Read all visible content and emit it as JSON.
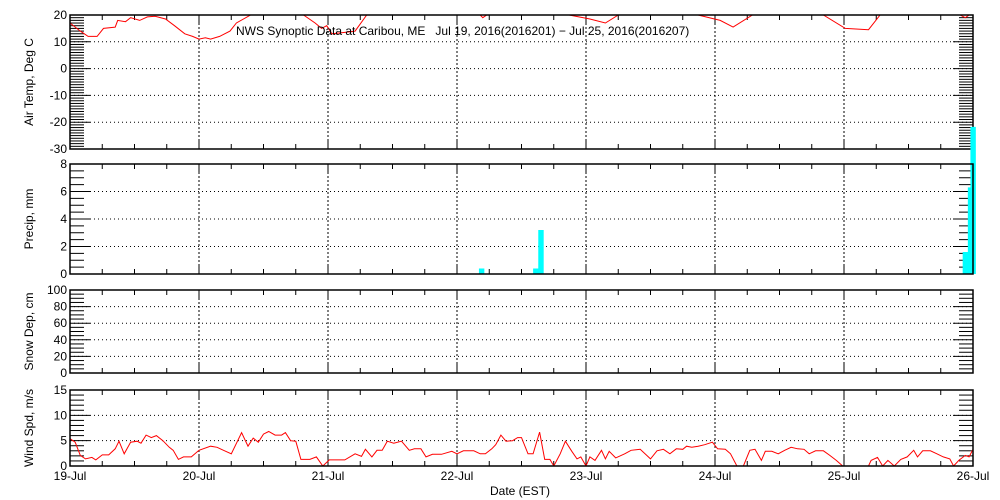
{
  "chart_data": {
    "type": "line",
    "title": "NWS Synoptic Data at Caribou, ME   Jul 19, 2016(2016201) − Jul 25, 2016(2016207)",
    "xlabel": "Date (EST)",
    "x_units": "days since 19-Jul 00:00",
    "xlim": [
      0,
      7
    ],
    "x_tick_labels": [
      "19-Jul",
      "20-Jul",
      "21-Jul",
      "22-Jul",
      "23-Jul",
      "24-Jul",
      "25-Jul",
      "26-Jul"
    ],
    "grid": true,
    "colors": {
      "line": "#ff0000",
      "bar": "#00ffff",
      "axis": "#000000"
    },
    "panels": [
      {
        "id": "temp",
        "ylabel": "Air Temp, Deg C",
        "ylim": [
          -30,
          20
        ],
        "ticks": [
          "-30",
          "-20",
          "-10",
          "0",
          "10",
          "20"
        ],
        "major": 10,
        "minor": 1,
        "kind": "line",
        "points": [
          [
            0,
            17
          ],
          [
            0.08,
            14
          ],
          [
            0.14,
            12
          ],
          [
            0.21,
            12
          ],
          [
            0.26,
            15
          ],
          [
            0.35,
            15.5
          ],
          [
            0.37,
            18
          ],
          [
            0.43,
            17.5
          ],
          [
            0.47,
            19
          ],
          [
            0.54,
            18
          ],
          [
            0.6,
            19.3
          ],
          [
            0.66,
            19.5
          ],
          [
            0.74,
            18.5
          ],
          [
            0.81,
            16
          ],
          [
            0.89,
            13
          ],
          [
            0.95,
            12
          ],
          [
            1.0,
            11
          ],
          [
            1.05,
            11.5
          ],
          [
            1.09,
            11
          ],
          [
            1.16,
            12
          ],
          [
            1.24,
            14
          ],
          [
            1.29,
            17
          ],
          [
            1.4,
            20
          ],
          [
            1.47,
            23
          ],
          [
            1.71,
            23
          ],
          [
            1.81,
            20
          ],
          [
            1.9,
            17
          ],
          [
            1.95,
            15
          ],
          [
            1.99,
            16
          ],
          [
            2.03,
            13
          ],
          [
            2.13,
            13.5
          ],
          [
            2.21,
            14
          ],
          [
            2.3,
            20
          ],
          [
            2.4,
            24
          ],
          [
            3.1,
            24
          ],
          [
            3.18,
            20
          ],
          [
            3.2,
            19
          ],
          [
            3.26,
            21
          ],
          [
            3.49,
            24
          ],
          [
            3.8,
            24
          ],
          [
            3.87,
            20
          ],
          [
            4.03,
            18.5
          ],
          [
            4.15,
            17
          ],
          [
            4.25,
            20
          ],
          [
            4.34,
            24
          ],
          [
            4.81,
            24
          ],
          [
            4.87,
            20
          ],
          [
            5.04,
            18
          ],
          [
            5.14,
            15.5
          ],
          [
            5.29,
            20
          ],
          [
            5.39,
            24
          ],
          [
            5.74,
            24
          ],
          [
            5.84,
            20
          ],
          [
            6.01,
            15
          ],
          [
            6.19,
            14.5
          ],
          [
            6.28,
            20
          ],
          [
            6.36,
            24
          ],
          [
            6.82,
            24
          ],
          [
            6.9,
            20
          ],
          [
            6.94,
            19
          ],
          [
            7.0,
            21
          ]
        ]
      },
      {
        "id": "precip",
        "ylabel": "Precip, mm",
        "ylim": [
          0,
          8
        ],
        "ticks": [
          "0",
          "2",
          "4",
          "6",
          "8"
        ],
        "major": 2,
        "minor": 0.5,
        "kind": "bar",
        "bar_width_days": 0.042,
        "bars": [
          [
            3.17,
            0.4
          ],
          [
            3.59,
            0.4
          ],
          [
            3.63,
            3.2
          ],
          [
            6.92,
            1.6
          ],
          [
            6.96,
            6.3
          ],
          [
            6.98,
            10.7
          ]
        ]
      },
      {
        "id": "snow",
        "ylabel": "Snow Dep, cm",
        "ylim": [
          0,
          100
        ],
        "ticks": [
          "0",
          "20",
          "40",
          "60",
          "80",
          "100"
        ],
        "major": 20,
        "minor": 5,
        "kind": "none"
      },
      {
        "id": "wind",
        "ylabel": "Wind Spd, m/s",
        "ylim": [
          0,
          15
        ],
        "ticks": [
          "0",
          "5",
          "10",
          "15"
        ],
        "major": 5,
        "minor": 1,
        "kind": "line",
        "points": [
          [
            0,
            5.4
          ],
          [
            0.04,
            4.7
          ],
          [
            0.08,
            2.1
          ],
          [
            0.12,
            1.4
          ],
          [
            0.17,
            1.7
          ],
          [
            0.2,
            1.2
          ],
          [
            0.25,
            2.2
          ],
          [
            0.3,
            2.2
          ],
          [
            0.35,
            3.4
          ],
          [
            0.38,
            4.9
          ],
          [
            0.42,
            2.4
          ],
          [
            0.47,
            4.7
          ],
          [
            0.52,
            4.9
          ],
          [
            0.55,
            4.5
          ],
          [
            0.59,
            6.1
          ],
          [
            0.63,
            5.6
          ],
          [
            0.67,
            6.0
          ],
          [
            0.72,
            5.0
          ],
          [
            0.77,
            3.7
          ],
          [
            0.8,
            3.1
          ],
          [
            0.84,
            1.3
          ],
          [
            0.88,
            1.8
          ],
          [
            0.94,
            1.8
          ],
          [
            1.0,
            3.1
          ],
          [
            1.09,
            3.9
          ],
          [
            1.14,
            3.7
          ],
          [
            1.19,
            3.1
          ],
          [
            1.25,
            2.4
          ],
          [
            1.33,
            6.6
          ],
          [
            1.38,
            3.9
          ],
          [
            1.42,
            5.5
          ],
          [
            1.46,
            4.7
          ],
          [
            1.5,
            6.3
          ],
          [
            1.54,
            6.8
          ],
          [
            1.59,
            6.1
          ],
          [
            1.64,
            6.1
          ],
          [
            1.67,
            6.6
          ],
          [
            1.71,
            5.0
          ],
          [
            1.75,
            4.9
          ],
          [
            1.79,
            1.3
          ],
          [
            1.86,
            1.3
          ],
          [
            1.91,
            1.8
          ],
          [
            1.96,
            0
          ],
          [
            2.01,
            1.2
          ],
          [
            2.13,
            1.2
          ],
          [
            2.21,
            2.4
          ],
          [
            2.26,
            1.9
          ],
          [
            2.29,
            3.3
          ],
          [
            2.34,
            1.8
          ],
          [
            2.38,
            3.1
          ],
          [
            2.42,
            3.1
          ],
          [
            2.46,
            4.9
          ],
          [
            2.51,
            4.5
          ],
          [
            2.57,
            4.9
          ],
          [
            2.63,
            3.1
          ],
          [
            2.67,
            3.4
          ],
          [
            2.72,
            3.4
          ],
          [
            2.76,
            1.8
          ],
          [
            2.81,
            2.3
          ],
          [
            2.88,
            2.3
          ],
          [
            2.96,
            2.9
          ],
          [
            3.0,
            2.4
          ],
          [
            3.05,
            3.0
          ],
          [
            3.13,
            3.0
          ],
          [
            3.18,
            2.4
          ],
          [
            3.22,
            2.4
          ],
          [
            3.27,
            3.4
          ],
          [
            3.3,
            4.2
          ],
          [
            3.34,
            6.1
          ],
          [
            3.38,
            4.9
          ],
          [
            3.43,
            5.0
          ],
          [
            3.47,
            5.6
          ],
          [
            3.5,
            5.6
          ],
          [
            3.55,
            2.4
          ],
          [
            3.59,
            2.4
          ],
          [
            3.64,
            6.7
          ],
          [
            3.68,
            1.3
          ],
          [
            3.72,
            1.3
          ],
          [
            3.75,
            0
          ],
          [
            3.8,
            2.4
          ],
          [
            3.84,
            4.9
          ],
          [
            3.89,
            2.9
          ],
          [
            3.93,
            1.4
          ],
          [
            3.96,
            1.8
          ],
          [
            4.0,
            0
          ],
          [
            4.03,
            1.8
          ],
          [
            4.07,
            1.1
          ],
          [
            4.12,
            3.1
          ],
          [
            4.15,
            1.4
          ],
          [
            4.18,
            2.9
          ],
          [
            4.23,
            1.6
          ],
          [
            4.3,
            2.4
          ],
          [
            4.35,
            3.1
          ],
          [
            4.42,
            3.3
          ],
          [
            4.5,
            1.4
          ],
          [
            4.55,
            3.0
          ],
          [
            4.6,
            3.3
          ],
          [
            4.65,
            2.4
          ],
          [
            4.7,
            3.4
          ],
          [
            4.75,
            3.3
          ],
          [
            4.78,
            3.9
          ],
          [
            4.82,
            3.7
          ],
          [
            4.87,
            3.9
          ],
          [
            4.92,
            4.2
          ],
          [
            4.98,
            4.7
          ],
          [
            5.02,
            3.4
          ],
          [
            5.08,
            3.3
          ],
          [
            5.12,
            2.4
          ],
          [
            5.17,
            0
          ],
          [
            5.22,
            0
          ],
          [
            5.27,
            3.1
          ],
          [
            5.31,
            3.3
          ],
          [
            5.36,
            1.1
          ],
          [
            5.39,
            2.9
          ],
          [
            5.44,
            2.9
          ],
          [
            5.49,
            2.4
          ],
          [
            5.54,
            3.1
          ],
          [
            5.59,
            3.7
          ],
          [
            5.64,
            3.4
          ],
          [
            5.69,
            3.3
          ],
          [
            5.73,
            2.4
          ],
          [
            5.78,
            3.0
          ],
          [
            5.84,
            3.0
          ],
          [
            5.89,
            2.1
          ],
          [
            5.94,
            1.1
          ],
          [
            5.99,
            0
          ],
          [
            6.19,
            0
          ],
          [
            6.21,
            1.1
          ],
          [
            6.26,
            1.7
          ],
          [
            6.3,
            0
          ],
          [
            6.34,
            1.1
          ],
          [
            6.39,
            0
          ],
          [
            6.44,
            1.3
          ],
          [
            6.49,
            1.8
          ],
          [
            6.54,
            3.1
          ],
          [
            6.57,
            1.8
          ],
          [
            6.61,
            3.0
          ],
          [
            6.67,
            3.0
          ],
          [
            6.72,
            2.4
          ],
          [
            6.77,
            1.8
          ],
          [
            6.82,
            1.4
          ],
          [
            6.85,
            0
          ],
          [
            6.89,
            1.1
          ],
          [
            6.94,
            2.1
          ],
          [
            6.97,
            1.8
          ],
          [
            7.0,
            3.3
          ]
        ]
      }
    ]
  }
}
